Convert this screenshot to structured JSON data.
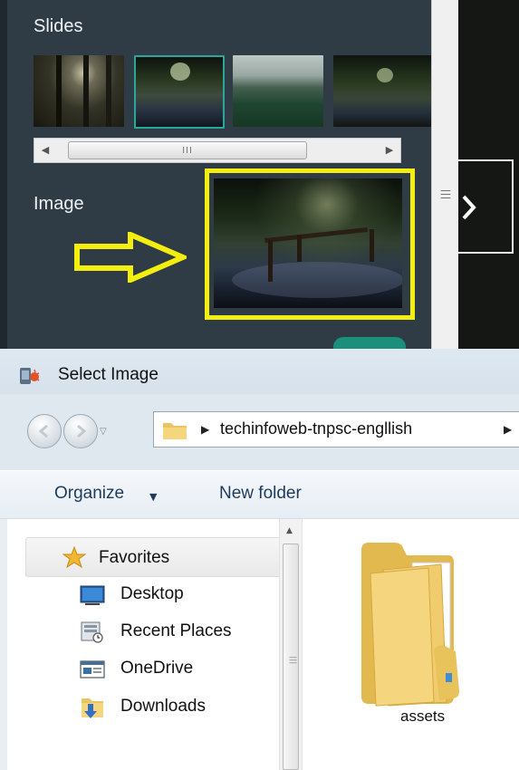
{
  "editor": {
    "slides_title": "Slides",
    "image_title": "Image",
    "scroll_grip": "III",
    "scroll_left_arrow": "◀",
    "scroll_right_arrow": "▶",
    "next_arrow": "next-chevron",
    "highlight_color": "#f3ee0f",
    "accent_color": "#2aa79a"
  },
  "dialog": {
    "title": "Select Image",
    "address": {
      "separator": "▶",
      "path": "techinfoweb-tnpsc-engllish",
      "trailing_separator": "▶"
    },
    "toolbar": {
      "organize_label": "Organize",
      "organize_caret": "▼",
      "new_folder_label": "New folder"
    },
    "nav": {
      "favorites_label": "Favorites",
      "items": [
        {
          "label": "Desktop",
          "icon": "desktop-icon"
        },
        {
          "label": "Recent Places",
          "icon": "recent-places-icon"
        },
        {
          "label": "OneDrive",
          "icon": "onedrive-icon"
        },
        {
          "label": "Downloads",
          "icon": "downloads-icon"
        }
      ]
    },
    "files": [
      {
        "name": "assets",
        "icon": "folder-icon"
      }
    ]
  }
}
